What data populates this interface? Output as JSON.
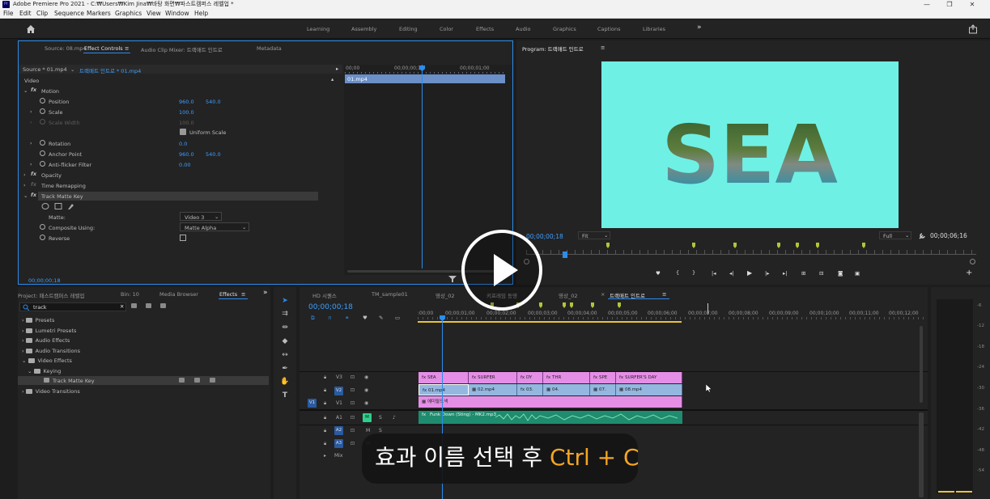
{
  "window": {
    "title": "Adobe Premiere Pro 2021 - C:₩Users₩Kim Jina₩바탕 화면₩파스트캠퍼스 레벨업 *",
    "minimize": "—",
    "maximize": "❐",
    "close": "✕"
  },
  "menu": [
    "File",
    "Edit",
    "Clip",
    "Sequence",
    "Markers",
    "Graphics",
    "View",
    "Window",
    "Help"
  ],
  "workspaces": [
    "Learning",
    "Assembly",
    "Editing",
    "Color",
    "Effects",
    "Audio",
    "Graphics",
    "Captions",
    "Libraries"
  ],
  "workspace_more": "»",
  "source_panel": {
    "tabs": [
      "Source: 08.mp4",
      "Effect Controls",
      "Audio Clip Mixer: 트랙매트 인트로",
      "Metadata"
    ],
    "active_tab": 1,
    "tab_menu": "≡",
    "source_label": "Source * 01.mp4",
    "sequence_label": "트랙매트 인트로 * 01.mp4",
    "video_header": "Video",
    "rows": [
      {
        "label": "Motion",
        "fx": true
      },
      {
        "label": "Position",
        "v1": "960.0",
        "v2": "540.0"
      },
      {
        "label": "Scale",
        "v1": "100.0"
      },
      {
        "label": "Scale Width",
        "v1": "100.0"
      },
      {
        "label": "Uniform Scale"
      },
      {
        "label": "Rotation",
        "v1": "0.0"
      },
      {
        "label": "Anchor Point",
        "v1": "960.0",
        "v2": "540.0"
      },
      {
        "label": "Anti-flicker Filter",
        "v1": "0.00"
      },
      {
        "label": "Opacity",
        "fx": true
      },
      {
        "label": "Time Remapping",
        "fx": true
      },
      {
        "label": "Track Matte Key",
        "fx": true
      },
      {
        "label": "Matte:",
        "dropdown": "Video 3"
      },
      {
        "label": "Composite Using:",
        "dropdown": "Matte Alpha"
      },
      {
        "label": "Reverse"
      }
    ],
    "mini_timeline": {
      "t0": "00;00",
      "t1": "00;00;00;16",
      "t2": "00;00;01;00",
      "clip": "01.mp4"
    },
    "timecode": "00;00;00;18"
  },
  "program": {
    "title": "Program: 트랙매트 인트로",
    "menu": "≡",
    "overlay_text": "SEA",
    "bg_color": "#6ff0e5",
    "timecode": "00;00;00;18",
    "fit": "Fit",
    "quality": "Full",
    "duration": "00;00;06;16"
  },
  "project_panel": {
    "tabs": [
      "Project: 패스트캠퍼스 레벨업",
      "Bin: 10",
      "Media Browser",
      "Effects"
    ],
    "effects_menu": "≡",
    "more": "»",
    "search_value": "track",
    "tree": [
      {
        "label": "Presets",
        "level": 0
      },
      {
        "label": "Lumetri Presets",
        "level": 0
      },
      {
        "label": "Audio Effects",
        "level": 0
      },
      {
        "label": "Audio Transitions",
        "level": 0
      },
      {
        "label": "Video Effects",
        "level": 0
      },
      {
        "label": "Keying",
        "level": 1
      },
      {
        "label": "Track Matte Key",
        "level": 2,
        "selected": true
      },
      {
        "label": "Video Transitions",
        "level": 0
      }
    ]
  },
  "timeline": {
    "tabs": [
      "HD 시퀀스",
      "TM_sample01",
      "영상_02",
      "키프레임 동영",
      "영상_02",
      "트랙매트 인트로"
    ],
    "active_tab": 5,
    "tab_menu": "≡",
    "timecode": "00;00;00;18",
    "ruler": [
      ":00;00",
      "00;00;01;00",
      "00;00;02;00",
      "00;00;03;00",
      "00;00;04;00",
      "00;00;05;00",
      "00;00;06;00",
      "00;00;07;00",
      "00;00;08;00",
      "00;00;09;00",
      "00;00;10;00",
      "00;00;11;00",
      "00;00;12;00"
    ],
    "tracks": [
      "V3",
      "V2",
      "V1",
      "A1",
      "A2",
      "A3",
      "Mix"
    ],
    "v3_clips": [
      "SEA",
      "SURFER",
      "DY",
      "THR",
      "SPE",
      "SURFER'S DAY"
    ],
    "v2_clips": [
      "01.mp4",
      "02.mp4",
      "03.",
      "04.",
      "07.",
      "08.mp4"
    ],
    "v1_clip": "에미랄드색",
    "a1_clip": "Funk Down (Sting) - MK2.mp3",
    "vu_labels": [
      "-6",
      "-12",
      "-18",
      "-24",
      "-30",
      "-36",
      "-42",
      "-48",
      "-54"
    ]
  },
  "caption": {
    "text_ko": "효과 이름 선택 후 ",
    "text_hotkey": "Ctrl + C"
  }
}
